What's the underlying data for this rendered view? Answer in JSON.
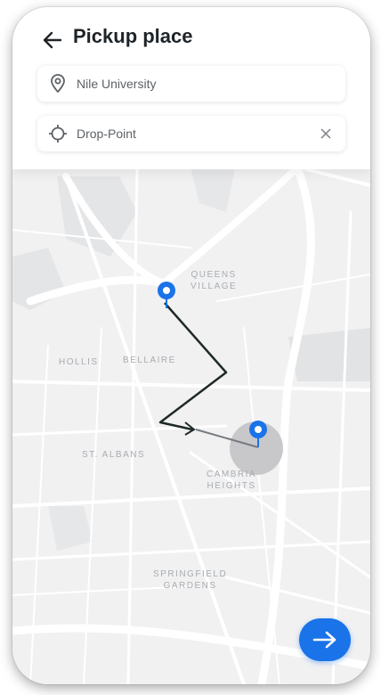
{
  "header": {
    "title": "Pickup place",
    "back_icon": "arrow-left-icon"
  },
  "pickup": {
    "value": "Nile University",
    "icon": "map-pin-icon"
  },
  "dropoff": {
    "value": "Drop-Point",
    "icon": "crosshair-icon",
    "clear_icon": "close-icon"
  },
  "map": {
    "labels": {
      "queens_village": "QUEENS\nVILLAGE",
      "hollis": "HOLLIS",
      "bellaire": "BELLAIRE",
      "st_albans": "ST. ALBANS",
      "cambria_heights": "CAMBRIA\nHEIGHTS",
      "springfield_gardens": "SPRINGFIELD\nGARDENS"
    },
    "pin_color": "#1a73e8",
    "route_color": "#1f2a28"
  },
  "next_button": {
    "icon": "arrow-right-icon",
    "color": "#1a73e8"
  }
}
